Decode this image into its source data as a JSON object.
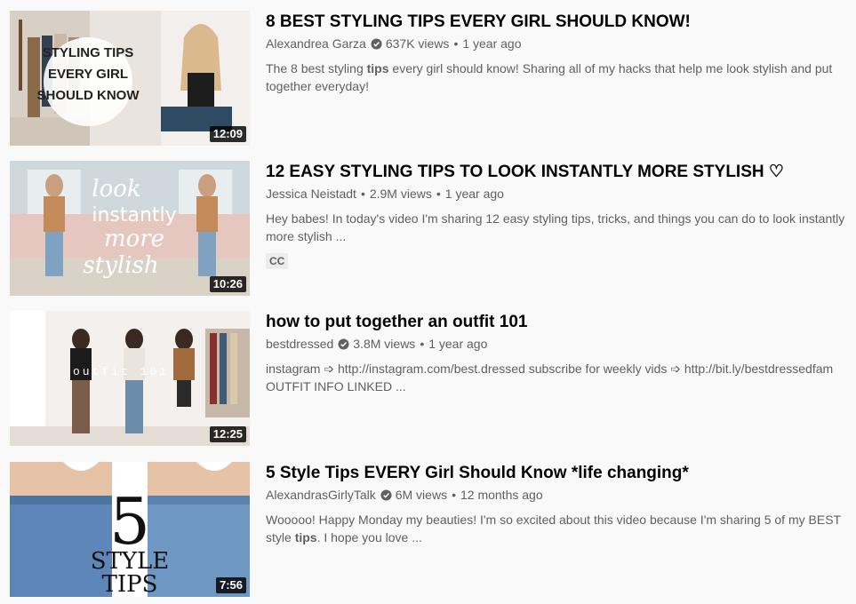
{
  "results": [
    {
      "title": "8 BEST STYLING TIPS EVERY GIRL SHOULD KNOW!",
      "channel": "Alexandrea Garza",
      "verified": true,
      "views": "637K views",
      "age": "1 year ago",
      "description_parts": [
        "The 8 best styling ",
        "tips",
        " every girl should know! Sharing all of my hacks that help me look stylish and put together everyday!"
      ],
      "duration": "12:09",
      "thumbnail_text": [
        "STYLING TIPS",
        "EVERY GIRL",
        "SHOULD KNOW"
      ]
    },
    {
      "title": "12 EASY STYLING TIPS TO LOOK INSTANTLY MORE STYLISH ♡",
      "channel": "Jessica Neistadt",
      "verified": false,
      "views": "2.9M views",
      "age": "1 year ago",
      "description_parts": [
        "Hey babes! In today's video I'm sharing 12 easy styling tips, tricks, and things you can do to look instantly more stylish ..."
      ],
      "badge": "CC",
      "duration": "10:26",
      "thumbnail_text": [
        "look",
        "instantly",
        "more",
        "stylish"
      ]
    },
    {
      "title": "how to put together an outfit 101",
      "channel": "bestdressed",
      "verified": true,
      "views": "3.8M views",
      "age": "1 year ago",
      "description_parts": [
        "instagram ➩ http://instagram.com/best.dressed subscribe for weekly vids ➩ http://bit.ly/bestdressedfam OUTFIT INFO LINKED ..."
      ],
      "duration": "12:25",
      "thumbnail_text": [
        "outfit 101"
      ]
    },
    {
      "title": "5 Style Tips EVERY Girl Should Know *life changing*",
      "channel": "AlexandrasGirlyTalk",
      "verified": true,
      "views": "6M views",
      "age": "12 months ago",
      "description_parts": [
        "Wooooo! Happy Monday my beauties! I'm so excited about this video because I'm sharing 5 of my BEST style ",
        "tips",
        ". I hope you love ..."
      ],
      "duration": "7:56",
      "thumbnail_text": [
        "5",
        "STYLE",
        "TIPS"
      ]
    }
  ],
  "icons": {
    "verified": "verified-check-icon"
  },
  "colors": {
    "title": "#030303",
    "meta": "#606060",
    "background": "#f9f9f9"
  }
}
